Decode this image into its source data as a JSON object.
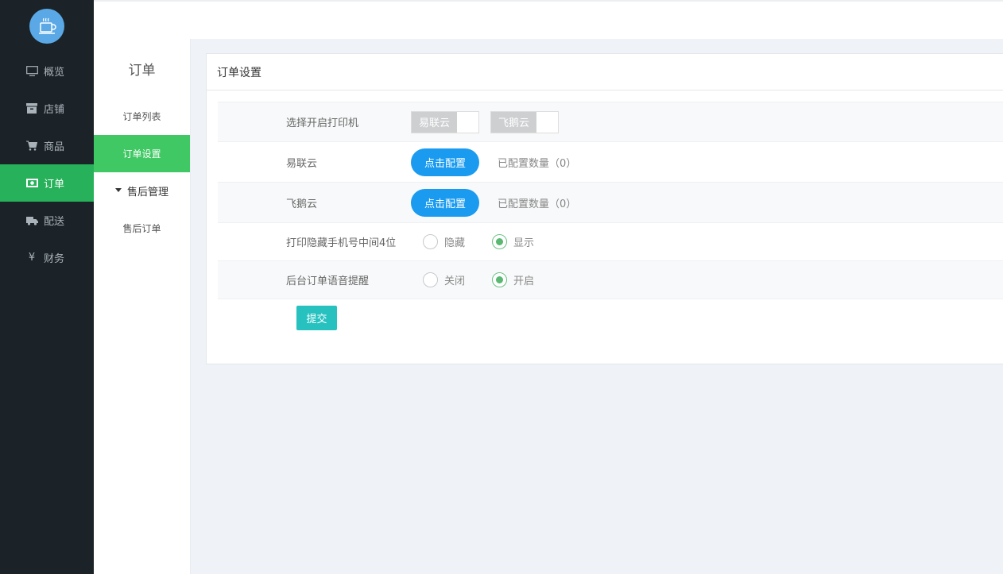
{
  "sidebar": {
    "logo_icon": "coffee-cup-icon",
    "items": [
      {
        "label": "概览",
        "icon": "monitor-icon"
      },
      {
        "label": "店铺",
        "icon": "store-icon"
      },
      {
        "label": "商品",
        "icon": "cart-icon"
      },
      {
        "label": "订单",
        "icon": "money-icon",
        "active": true
      },
      {
        "label": "配送",
        "icon": "truck-icon"
      },
      {
        "label": "财务",
        "icon": "yen-icon"
      }
    ],
    "active_color": "#27b15a"
  },
  "subnav": {
    "title": "订单",
    "items": [
      {
        "label": "订单列表"
      },
      {
        "label": "订单设置",
        "active": true
      }
    ],
    "group": {
      "label": "售后管理",
      "items": [
        {
          "label": "售后订单"
        }
      ]
    }
  },
  "panel": {
    "title": "订单设置",
    "rows": {
      "printer": {
        "label": "选择开启打印机",
        "switches": [
          {
            "label": "易联云",
            "on": false
          },
          {
            "label": "飞鹅云",
            "on": false
          }
        ]
      },
      "yilianyun": {
        "label": "易联云",
        "button": "点击配置",
        "count_text": "已配置数量（0）"
      },
      "feieyun": {
        "label": "飞鹅云",
        "button": "点击配置",
        "count_text": "已配置数量（0）"
      },
      "hide_phone": {
        "label": "打印隐藏手机号中间4位",
        "options": [
          {
            "label": "隐藏",
            "checked": false
          },
          {
            "label": "显示",
            "checked": true
          }
        ]
      },
      "voice": {
        "label": "后台订单语音提醒",
        "options": [
          {
            "label": "关闭",
            "checked": false
          },
          {
            "label": "开启",
            "checked": true
          }
        ]
      }
    },
    "submit_label": "提交"
  },
  "colors": {
    "primary_button": "#1a9bf0",
    "submit_button": "#27c2c0",
    "subnav_active": "#3fc863",
    "radio_checked": "#5ab872"
  }
}
